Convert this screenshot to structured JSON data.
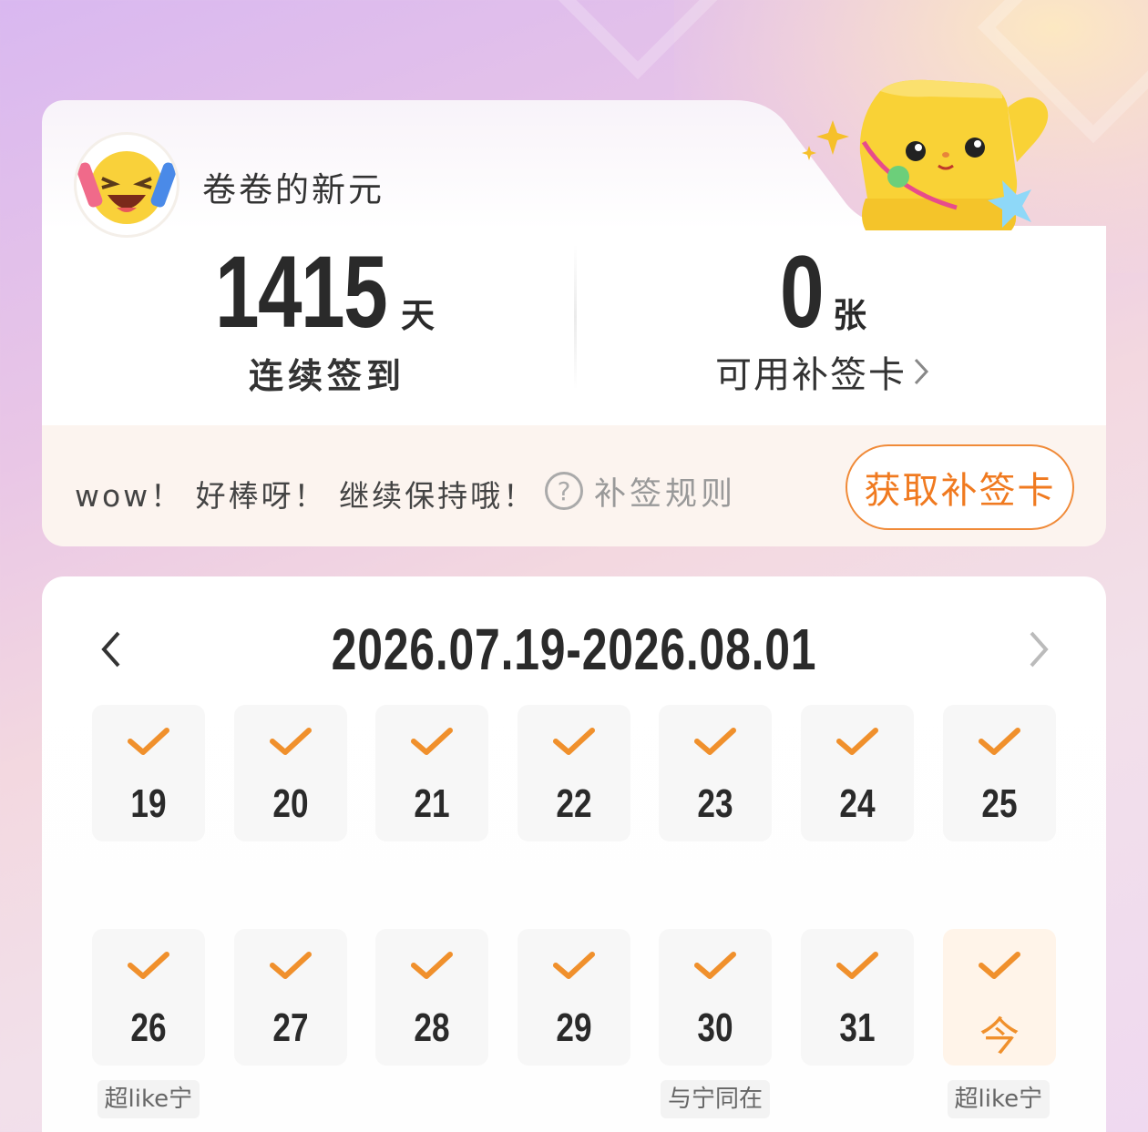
{
  "user": {
    "name": "卷卷的新元"
  },
  "stats": {
    "streak_value": "1415",
    "streak_unit": "天",
    "streak_label": "连续签到",
    "cards_value": "0",
    "cards_unit": "张",
    "cards_label": "可用补签卡",
    "cards_chevron": "›"
  },
  "rules": {
    "message": "wow！ 好棒呀！ 继续保持哦！",
    "rules_icon": "question-circle-icon",
    "rules_glyph": "?",
    "rules_label": "补签规则",
    "get_card_label": "获取补签卡"
  },
  "calendar": {
    "range": "2026.07.19-2026.08.01",
    "prev_icon": "chevron-left-icon",
    "next_icon": "chevron-right-icon",
    "check_color": "#f0902c",
    "days": [
      {
        "label": "19",
        "checked": true
      },
      {
        "label": "20",
        "checked": true
      },
      {
        "label": "21",
        "checked": true
      },
      {
        "label": "22",
        "checked": true
      },
      {
        "label": "23",
        "checked": true
      },
      {
        "label": "24",
        "checked": true
      },
      {
        "label": "25",
        "checked": true
      },
      {
        "label": "26",
        "checked": true,
        "tag": "超like宁"
      },
      {
        "label": "27",
        "checked": true
      },
      {
        "label": "28",
        "checked": true
      },
      {
        "label": "29",
        "checked": true
      },
      {
        "label": "30",
        "checked": true,
        "tag": "与宁同在"
      },
      {
        "label": "31",
        "checked": true
      },
      {
        "label": "今",
        "checked": true,
        "today": true,
        "tag": "超like宁"
      }
    ]
  },
  "colors": {
    "accent": "#f07a20",
    "rule_bg": "#fcf4ef"
  }
}
